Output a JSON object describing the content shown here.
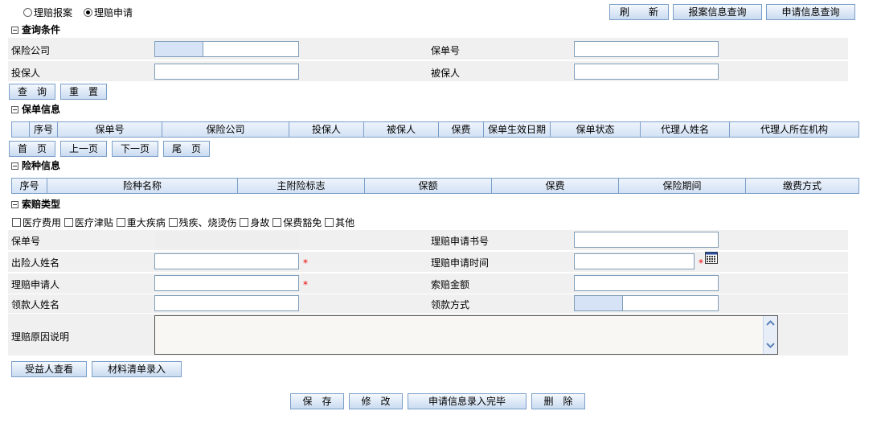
{
  "mode": {
    "report_label": "理赔报案",
    "apply_label": "理赔申请"
  },
  "top_buttons": {
    "refresh": "刷　　新",
    "report_query": "报案信息查询",
    "apply_query": "申请信息查询"
  },
  "query": {
    "title": "查询条件",
    "company_label": "保险公司",
    "policy_no_label": "保单号",
    "applicant_label": "投保人",
    "insured_label": "被保人",
    "search_btn": "查　询",
    "reset_btn": "重　置"
  },
  "policy": {
    "title": "保单信息",
    "columns": [
      "",
      "序号",
      "保单号",
      "保险公司",
      "投保人",
      "被保人",
      "保费",
      "保单生效日期",
      "保单状态",
      "代理人姓名",
      "代理人所在机构"
    ]
  },
  "pager": {
    "first": "首　页",
    "prev": "上一页",
    "next": "下一页",
    "last": "尾　页"
  },
  "coverage": {
    "title": "险种信息",
    "columns": [
      "序号",
      "险种名称",
      "主附险标志",
      "保额",
      "保费",
      "保险期间",
      "缴费方式"
    ]
  },
  "claim_type": {
    "title": "索赔类型",
    "options": [
      "医疗费用",
      "医疗津贴",
      "重大疾病",
      "残疾、烧烫伤",
      "身故",
      "保费豁免",
      "其他"
    ]
  },
  "claim_form": {
    "policy_no_label": "保单号",
    "app_no_label": "理赔申请书号",
    "person_name_label": "出险人姓名",
    "app_time_label": "理赔申请时间",
    "applicant_label": "理赔申请人",
    "amount_label": "索赔金额",
    "payee_label": "领款人姓名",
    "pay_method_label": "领款方式",
    "reason_label": "理赔原因说明",
    "required_mark": "*"
  },
  "sub_buttons": {
    "beneficiary": "受益人查看",
    "materials": "材料清单录入"
  },
  "bottom_buttons": {
    "save": "保　存",
    "modify": "修　改",
    "finish": "申请信息录入完毕",
    "delete": "删　除"
  }
}
